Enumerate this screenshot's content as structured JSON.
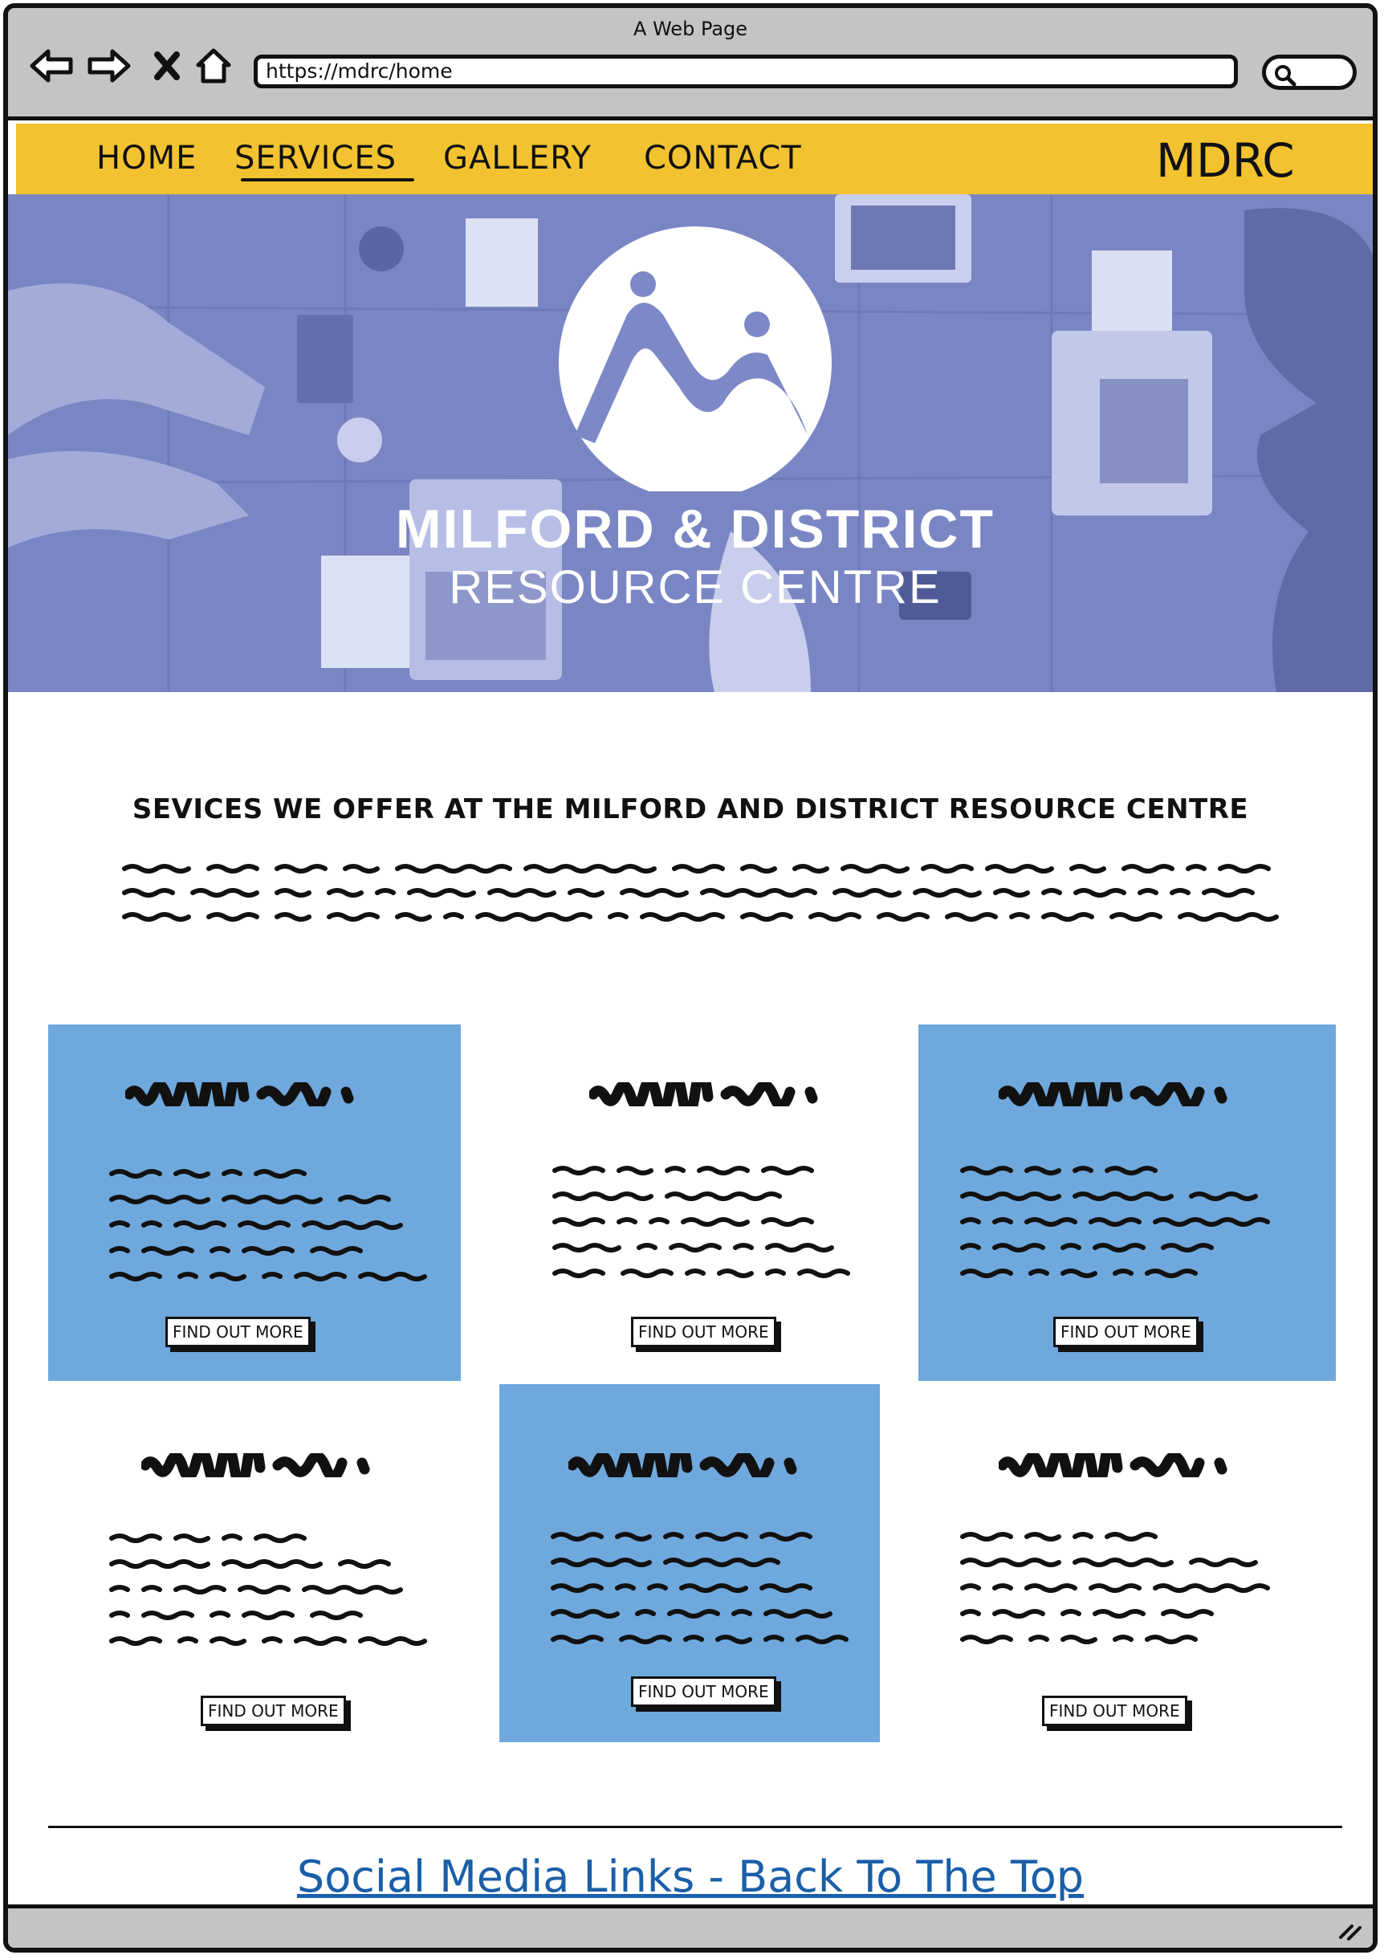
{
  "browser": {
    "window_title": "A Web Page",
    "url": "https://mdrc/home",
    "icons": [
      "back-arrow-icon",
      "forward-arrow-icon",
      "close-x-icon",
      "home-icon",
      "search-icon"
    ]
  },
  "nav": {
    "items": [
      {
        "label": "HOME"
      },
      {
        "label": "SERVICES",
        "active": true
      },
      {
        "label": "GALLERY"
      },
      {
        "label": "CONTACT"
      }
    ],
    "brand": "MDRC",
    "bg_color": "#f2c230"
  },
  "hero": {
    "title": "MILFORD & DISTRICT",
    "subtitle": "RESOURCE CENTRE",
    "overlay_color": "#7d89c6"
  },
  "intro": {
    "heading": "SEVICES WE OFFER AT THE MILFORD AND DISTRICT RESOURCE CENTRE"
  },
  "cards": [
    {
      "button_label": "FIND OUT MORE",
      "highlighted": true
    },
    {
      "button_label": "FIND OUT MORE",
      "highlighted": false
    },
    {
      "button_label": "FIND OUT MORE",
      "highlighted": true
    },
    {
      "button_label": "FIND OUT MORE",
      "highlighted": false
    },
    {
      "button_label": "FIND OUT MORE",
      "highlighted": true
    },
    {
      "button_label": "FIND OUT MORE",
      "highlighted": false
    }
  ],
  "card_color": "#6fa8dc",
  "footer": {
    "link_label": "Social Media Links - Back To The Top",
    "link_color": "#1a5fa8"
  }
}
